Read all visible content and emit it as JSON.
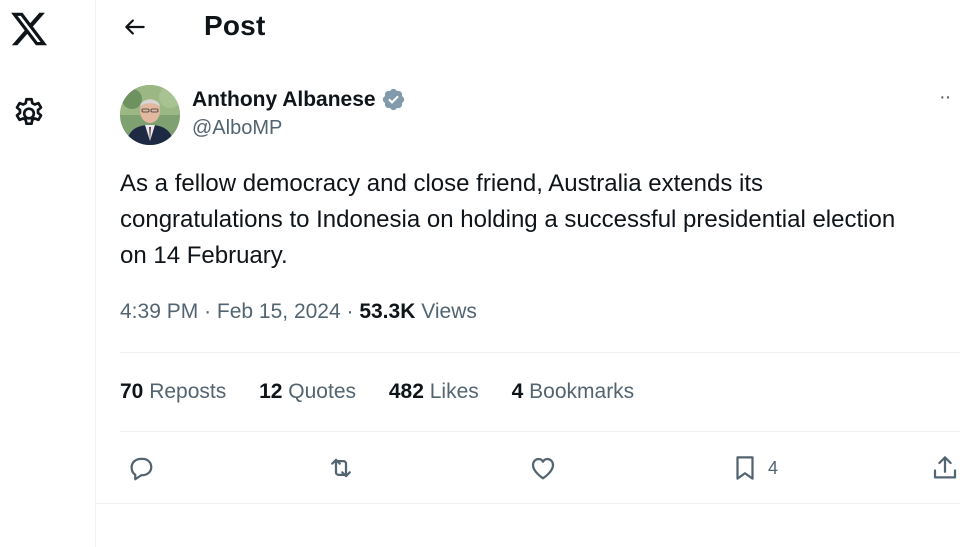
{
  "header": {
    "title": "Post"
  },
  "author": {
    "name": "Anthony Albanese",
    "handle": "@AlboMP",
    "verified_color": "#829aab"
  },
  "tweet": {
    "text": "As a fellow democracy and close friend, Australia extends its congratulations to Indonesia on holding a successful presidential election on 14 February.",
    "time": "4:39 PM",
    "date": "Feb 15, 2024",
    "views_count": "53.3K",
    "views_label": "Views"
  },
  "stats": {
    "reposts_count": "70",
    "reposts_label": "Reposts",
    "quotes_count": "12",
    "quotes_label": "Quotes",
    "likes_count": "482",
    "likes_label": "Likes",
    "bookmarks_count": "4",
    "bookmarks_label": "Bookmarks"
  },
  "actions": {
    "reply_icon": "reply-icon",
    "repost_icon": "repost-icon",
    "like_icon": "heart-icon",
    "bookmark_icon": "bookmark-icon",
    "bookmark_count": "4",
    "share_icon": "share-icon"
  },
  "more_label": "··"
}
